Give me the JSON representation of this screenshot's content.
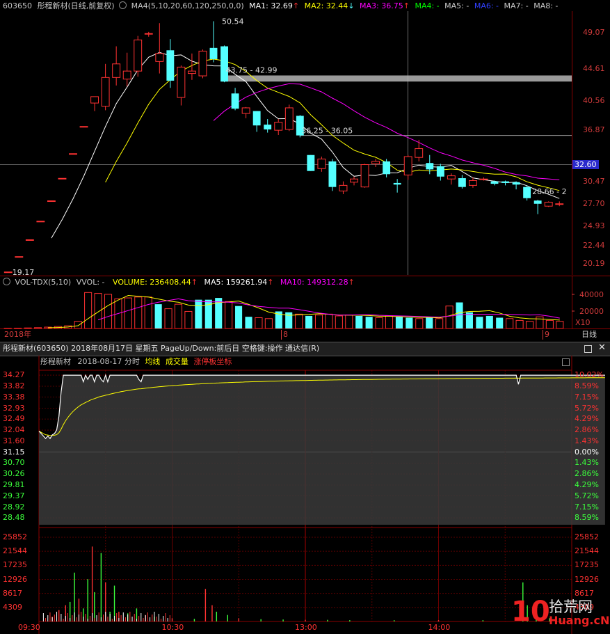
{
  "kline": {
    "header": {
      "code": "603650",
      "name_period": "彤程新材(日线,前复权)",
      "ma_label": "MA4(5,10,20,60,120,250,0,0)",
      "ma1": "MA1: 32.69",
      "ma2": "MA2: 32.44",
      "ma3": "MA3: 36.75",
      "ma4": "MA4: -",
      "ma5": "MA5: -",
      "ma6": "MA6: -",
      "ma7": "MA7: -",
      "ma8": "MA8: -"
    },
    "price_ticks": [
      "49.07",
      "44.61",
      "40.56",
      "36.87",
      "32.60",
      "30.47",
      "27.70",
      "24.93",
      "22.44",
      "20.19"
    ],
    "annotations": {
      "high": "50.54",
      "low": "19.17",
      "gap1": "43.75 - 42.99",
      "gap2": "36.25 - 36.05",
      "last": "28.66 - 2",
      "current_price": "32.60"
    },
    "year_label": "2018年",
    "month_label": "8",
    "month_label2": "9",
    "period_label": "日线",
    "colors": {
      "up": "#ff3232",
      "down": "#54ffff",
      "ma1": "#ffffff",
      "ma2": "#ffff00",
      "ma3": "#ff00ff"
    },
    "chart_data": {
      "type": "candlestick",
      "candles": [
        {
          "o": 19.17,
          "h": 19.17,
          "l": 19.17,
          "c": 19.17
        },
        {
          "o": 21.09,
          "h": 21.09,
          "l": 21.09,
          "c": 21.09
        },
        {
          "o": 23.2,
          "h": 23.2,
          "l": 23.2,
          "c": 23.2
        },
        {
          "o": 25.52,
          "h": 25.52,
          "l": 25.52,
          "c": 25.52
        },
        {
          "o": 28.07,
          "h": 28.07,
          "l": 28.07,
          "c": 28.07
        },
        {
          "o": 30.88,
          "h": 30.88,
          "l": 30.88,
          "c": 30.88
        },
        {
          "o": 33.97,
          "h": 33.97,
          "l": 33.97,
          "c": 33.97
        },
        {
          "o": 37.37,
          "h": 37.37,
          "l": 37.37,
          "c": 37.37
        },
        {
          "o": 40.3,
          "h": 41.0,
          "l": 39.3,
          "c": 41.1
        },
        {
          "o": 39.9,
          "h": 45.2,
          "l": 39.4,
          "c": 43.5
        },
        {
          "o": 43.5,
          "h": 47.4,
          "l": 42.5,
          "c": 45.2
        },
        {
          "o": 43.3,
          "h": 46.6,
          "l": 42.4,
          "c": 44.3
        },
        {
          "o": 44.3,
          "h": 48.7,
          "l": 43.6,
          "c": 48.2
        },
        {
          "o": 49.0,
          "h": 49.2,
          "l": 48.6,
          "c": 49.0
        },
        {
          "o": 45.5,
          "h": 50.3,
          "l": 44.0,
          "c": 46.5
        },
        {
          "o": 46.9,
          "h": 48.3,
          "l": 42.2,
          "c": 43.1
        },
        {
          "o": 41.0,
          "h": 45.0,
          "l": 40.0,
          "c": 44.8
        },
        {
          "o": 44.0,
          "h": 46.5,
          "l": 43.2,
          "c": 44.3
        },
        {
          "o": 43.7,
          "h": 47.0,
          "l": 43.4,
          "c": 46.8
        },
        {
          "o": 47.2,
          "h": 50.54,
          "l": 45.4,
          "c": 45.8
        },
        {
          "o": 47.4,
          "h": 47.5,
          "l": 42.9,
          "c": 42.99
        },
        {
          "o": 41.5,
          "h": 42.2,
          "l": 39.4,
          "c": 39.6
        },
        {
          "o": 39.0,
          "h": 39.8,
          "l": 38.4,
          "c": 39.7
        },
        {
          "o": 39.3,
          "h": 39.3,
          "l": 36.7,
          "c": 37.5
        },
        {
          "o": 37.6,
          "h": 38.3,
          "l": 36.6,
          "c": 37.0
        },
        {
          "o": 36.9,
          "h": 38.3,
          "l": 36.3,
          "c": 37.9
        },
        {
          "o": 37.0,
          "h": 40.1,
          "l": 36.8,
          "c": 39.7
        },
        {
          "o": 38.7,
          "h": 38.8,
          "l": 36.0,
          "c": 36.25
        },
        {
          "o": 33.8,
          "h": 33.8,
          "l": 31.8,
          "c": 31.8
        },
        {
          "o": 32.1,
          "h": 33.6,
          "l": 31.7,
          "c": 33.3
        },
        {
          "o": 33.0,
          "h": 33.3,
          "l": 29.3,
          "c": 29.8
        },
        {
          "o": 29.3,
          "h": 30.5,
          "l": 28.9,
          "c": 30.0
        },
        {
          "o": 30.4,
          "h": 31.1,
          "l": 30.0,
          "c": 30.8
        },
        {
          "o": 29.8,
          "h": 32.7,
          "l": 29.7,
          "c": 32.6
        },
        {
          "o": 32.7,
          "h": 33.3,
          "l": 32.3,
          "c": 33.0
        },
        {
          "o": 33.0,
          "h": 33.3,
          "l": 31.0,
          "c": 31.4
        },
        {
          "o": 30.3,
          "h": 30.8,
          "l": 29.1,
          "c": 30.1
        },
        {
          "o": 31.3,
          "h": 33.8,
          "l": 30.7,
          "c": 33.6
        },
        {
          "o": 33.5,
          "h": 35.7,
          "l": 33.0,
          "c": 34.6
        },
        {
          "o": 32.8,
          "h": 33.8,
          "l": 31.4,
          "c": 32.0
        },
        {
          "o": 32.4,
          "h": 32.7,
          "l": 30.6,
          "c": 31.1
        },
        {
          "o": 30.8,
          "h": 31.5,
          "l": 30.1,
          "c": 31.2
        },
        {
          "o": 30.9,
          "h": 31.3,
          "l": 29.6,
          "c": 29.8
        },
        {
          "o": 30.0,
          "h": 31.0,
          "l": 29.7,
          "c": 30.6
        },
        {
          "o": 30.8,
          "h": 31.0,
          "l": 30.6,
          "c": 30.8
        },
        {
          "o": 30.5,
          "h": 30.6,
          "l": 30.0,
          "c": 30.2
        },
        {
          "o": 30.5,
          "h": 30.6,
          "l": 30.0,
          "c": 30.3
        },
        {
          "o": 30.4,
          "h": 30.5,
          "l": 29.5,
          "c": 30.1
        },
        {
          "o": 29.8,
          "h": 30.0,
          "l": 28.1,
          "c": 28.4
        },
        {
          "o": 28.1,
          "h": 28.2,
          "l": 26.4,
          "c": 27.7
        },
        {
          "o": 27.4,
          "h": 28.0,
          "l": 27.3,
          "c": 27.9
        },
        {
          "o": 27.7,
          "h": 28.0,
          "l": 27.4,
          "c": 27.7
        }
      ]
    }
  },
  "volume": {
    "header": {
      "title": "VOL-TDX(5,10)",
      "vvol": "VVOL: -",
      "volume": "VOLUME: 236408.44",
      "ma5": "MA5: 159261.94",
      "ma10": "MA10: 149312.28"
    },
    "ticks": [
      "40000",
      "20000"
    ],
    "unit": "X10",
    "chart_data": {
      "type": "bar",
      "values": [
        300,
        400,
        600,
        900,
        1500,
        2200,
        3000,
        8000,
        40000,
        39000,
        38000,
        33000,
        34000,
        35000,
        35000,
        27000,
        22000,
        27000,
        19000,
        32000,
        32000,
        34000,
        30000,
        25000,
        13000,
        12000,
        11000,
        19000,
        18000,
        16000,
        14000,
        15000,
        16000,
        14000,
        15000,
        14000,
        13000,
        12000,
        14000,
        13000,
        12000,
        11000,
        12000,
        11000,
        25000,
        29000,
        18000,
        13000,
        14000,
        12000,
        11000,
        9000,
        8000,
        13000,
        9000,
        8000
      ]
    }
  },
  "minute": {
    "window_title": "彤程新材(603650) 2018年08月17日 星期五 PageUp/Down:前后日 空格键:操作 通达信(R)",
    "subheader": {
      "name": "彤程新材",
      "date": "2018-08-17 分时",
      "avg": "均线",
      "vol": "成交量",
      "limit": "涨停板坐标"
    },
    "left_prices": [
      "34.27",
      "33.82",
      "33.38",
      "32.93",
      "32.49",
      "32.04",
      "31.60",
      "31.15",
      "30.70",
      "30.26",
      "29.81",
      "29.37",
      "28.92",
      "28.48"
    ],
    "right_pcts": [
      "10.02%",
      "8.59%",
      "7.15%",
      "5.72%",
      "4.29%",
      "2.86%",
      "1.43%",
      "0.00%",
      "1.43%",
      "2.86%",
      "4.29%",
      "5.72%",
      "7.15%",
      "8.59%"
    ],
    "vol_ticks": [
      "25852",
      "21544",
      "17235",
      "12926",
      "8617",
      "4309"
    ],
    "time_labels": [
      "09:30",
      "10:30",
      "13:00",
      "14:00"
    ],
    "watermark": {
      "num": "10",
      "cn": "拾荒网",
      "url": "Huang.cN"
    },
    "colors": {
      "up": "#ff3232",
      "down": "#3cff3c",
      "flat": "#ffffff",
      "avg": "#ffff00"
    },
    "chart_data": {
      "type": "line",
      "price_ref": 31.15,
      "limit_up": 34.27,
      "price": [
        32.0,
        31.9,
        31.8,
        31.7,
        31.8,
        31.7,
        31.85,
        31.9,
        32.05,
        32.6,
        33.6,
        34.27,
        34.27,
        34.27,
        34.27,
        34.27,
        34.27,
        34.27,
        34.27,
        34.27,
        34.0,
        34.27,
        34.1,
        34.27,
        34.27,
        34.0,
        34.27,
        34.27,
        34.1,
        34.0,
        34.27,
        34.0,
        34.27,
        34.27,
        34.27,
        34.27,
        34.27,
        34.27,
        34.27,
        34.27,
        34.27,
        34.27,
        34.27,
        34.27,
        34.27,
        34.1,
        34.0,
        34.27,
        34.27,
        34.27,
        34.27,
        34.27,
        34.27,
        34.27,
        34.27,
        34.27,
        34.27,
        34.27,
        34.27,
        34.27,
        34.27,
        34.27,
        34.27,
        34.27,
        34.27,
        34.27,
        34.27,
        34.27,
        34.27,
        34.27,
        34.27,
        34.27,
        34.27,
        34.27,
        34.27,
        34.27,
        34.27,
        34.27,
        34.27,
        34.27,
        34.27,
        34.27,
        34.27,
        34.27,
        34.27,
        34.27,
        34.27,
        34.27,
        34.27,
        34.27,
        34.27,
        34.27,
        34.27,
        34.27,
        34.27,
        34.27,
        34.27,
        34.27,
        34.27,
        34.27,
        34.27,
        34.27,
        34.27,
        34.27,
        34.27,
        34.27,
        34.27,
        34.27,
        34.27,
        34.27,
        34.27,
        34.27,
        34.27,
        34.27,
        34.27,
        34.27,
        34.27,
        34.27,
        34.27,
        34.27,
        34.27,
        34.27,
        34.27,
        34.27,
        34.27,
        34.27,
        34.27,
        34.27,
        34.27,
        34.27,
        34.27,
        34.27,
        34.27,
        34.27,
        34.27,
        34.27,
        34.27,
        34.27,
        34.27,
        34.27,
        34.27,
        34.27,
        34.27,
        34.27,
        34.27,
        34.27,
        34.27,
        34.27,
        34.27,
        34.27,
        34.27,
        34.27,
        34.27,
        34.27,
        34.27,
        34.27,
        34.27,
        34.27,
        34.27,
        34.27,
        34.27,
        34.27,
        34.27,
        34.27,
        34.27,
        34.27,
        34.27,
        34.27,
        34.27,
        34.27,
        34.27,
        34.27,
        34.27,
        34.27,
        34.27,
        34.27,
        34.27,
        34.27,
        34.27,
        34.27,
        34.27,
        34.27,
        34.27,
        34.27,
        34.27,
        34.27,
        34.27,
        34.27,
        34.27,
        34.27,
        34.27,
        34.27,
        34.27,
        34.27,
        34.27,
        34.27,
        34.27,
        34.27,
        34.27,
        34.27,
        34.27,
        34.27,
        34.27,
        34.27,
        34.27,
        34.27,
        34.27,
        34.27,
        34.27,
        34.27,
        34.27,
        34.27,
        34.27,
        34.27,
        34.27,
        34.27,
        33.9,
        34.27,
        34.27,
        34.27,
        34.27,
        34.27,
        34.27,
        34.27,
        34.27,
        34.27,
        34.27,
        34.27,
        34.27,
        34.27,
        34.27,
        34.27,
        34.27,
        34.27,
        34.27,
        34.27,
        34.27,
        34.27,
        34.27,
        34.27,
        34.27,
        34.27,
        34.27,
        34.27,
        34.27,
        34.27,
        34.27,
        34.27,
        34.27,
        34.27,
        34.27,
        34.27,
        34.27,
        34.27,
        34.27,
        34.27
      ],
      "vol_spikes": [
        {
          "i": 6,
          "v": 1500
        },
        {
          "i": 9,
          "v": 3500
        },
        {
          "i": 12,
          "v": 5000
        },
        {
          "i": 14,
          "v": 6000
        },
        {
          "i": 16,
          "v": 15000
        },
        {
          "i": 18,
          "v": 7000
        },
        {
          "i": 20,
          "v": 4000
        },
        {
          "i": 22,
          "v": 13000
        },
        {
          "i": 24,
          "v": 23000
        },
        {
          "i": 25,
          "v": 9000
        },
        {
          "i": 28,
          "v": 21000
        },
        {
          "i": 30,
          "v": 12000
        },
        {
          "i": 32,
          "v": 3000
        },
        {
          "i": 34,
          "v": 11000
        },
        {
          "i": 36,
          "v": 3000
        },
        {
          "i": 40,
          "v": 2500
        },
        {
          "i": 44,
          "v": 4000
        },
        {
          "i": 48,
          "v": 2000
        },
        {
          "i": 52,
          "v": 1500
        },
        {
          "i": 60,
          "v": 1000
        },
        {
          "i": 70,
          "v": 800
        },
        {
          "i": 75,
          "v": 10000
        },
        {
          "i": 78,
          "v": 5000
        },
        {
          "i": 80,
          "v": 3000
        },
        {
          "i": 85,
          "v": 2000
        },
        {
          "i": 90,
          "v": 1000
        },
        {
          "i": 100,
          "v": 700
        },
        {
          "i": 110,
          "v": 600
        },
        {
          "i": 120,
          "v": 500
        },
        {
          "i": 130,
          "v": 500
        },
        {
          "i": 140,
          "v": 400
        },
        {
          "i": 160,
          "v": 400
        },
        {
          "i": 180,
          "v": 400
        },
        {
          "i": 200,
          "v": 400
        },
        {
          "i": 218,
          "v": 12000
        },
        {
          "i": 220,
          "v": 5000
        },
        {
          "i": 224,
          "v": 2000
        },
        {
          "i": 230,
          "v": 1000
        },
        {
          "i": 235,
          "v": 800
        }
      ]
    }
  }
}
